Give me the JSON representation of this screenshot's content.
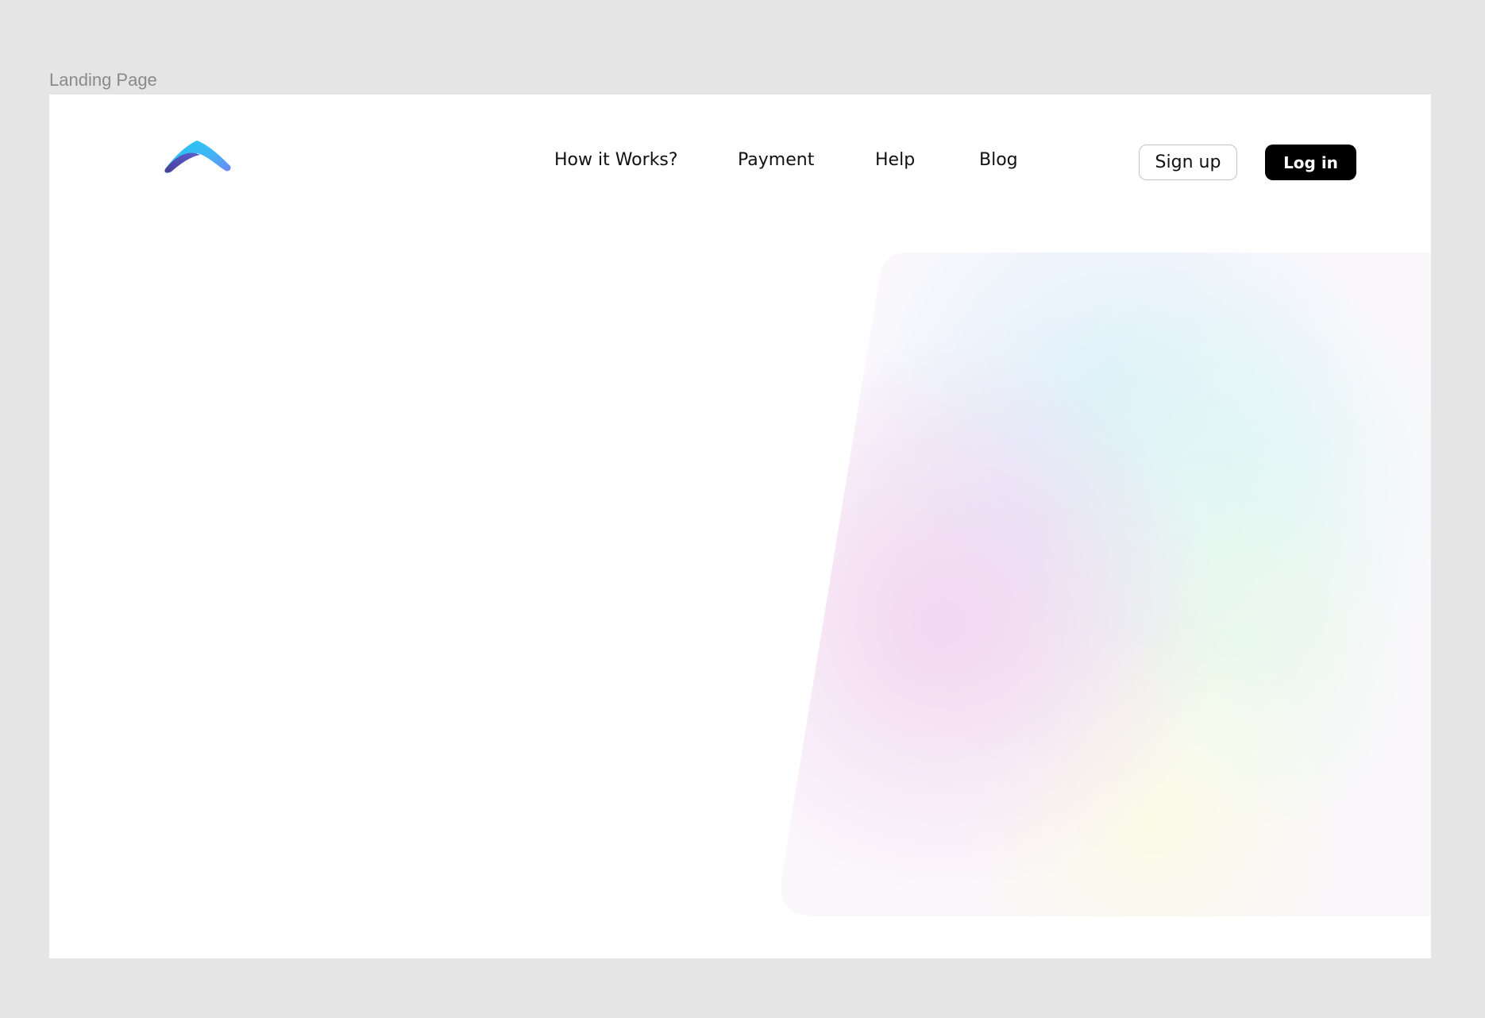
{
  "canvas": {
    "frame_label": "Landing Page"
  },
  "header": {
    "logo_icon": "chevron-up-logo-icon",
    "nav": [
      {
        "label": "How it Works?"
      },
      {
        "label": "Payment"
      },
      {
        "label": "Help"
      },
      {
        "label": "Blog"
      }
    ],
    "signup_label": "Sign up",
    "login_label": "Log in"
  },
  "hero": {
    "art": "gradient-blob-shape"
  },
  "colors": {
    "canvas_background": "#e5e5e5",
    "page_background": "#ffffff",
    "logo_gradient_start": "#25c8f5",
    "logo_gradient_end": "#5b45a8",
    "primary_button": "#000000",
    "gradient_pink": "#f3d9f1",
    "gradient_blue": "#dff3fb",
    "gradient_green": "#e5f8ea",
    "gradient_yellow": "#fbfbe8"
  }
}
